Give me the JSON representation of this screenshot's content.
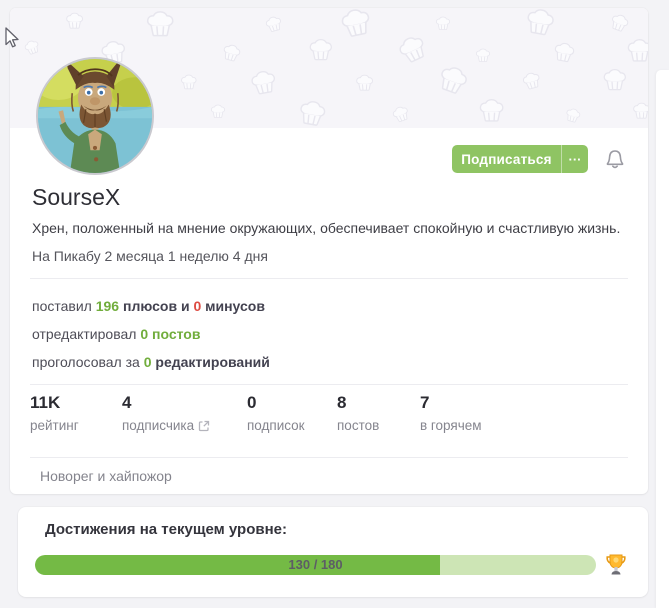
{
  "header": {
    "subscribe_label": "Подписаться",
    "more_label": "···"
  },
  "profile": {
    "username": "SourseX",
    "bio": "Хрен, положенный на мнение окружающих, обеспечивает спокойную и счастливую жизнь.",
    "tenure": "На Пикабу 2 месяца 1 неделю 4 дня"
  },
  "activity": {
    "line1": {
      "t1": "поставил ",
      "v1": "196",
      "t2": " плюсов и ",
      "v2": "0",
      "t3": " минусов"
    },
    "line2": {
      "t1": "отредактировал ",
      "v1": "0 постов"
    },
    "line3": {
      "t1": "проголосовал за ",
      "v1": "0",
      "t2": " редактирований"
    }
  },
  "counters": [
    {
      "value": "11K",
      "label": "рейтинг"
    },
    {
      "value": "4",
      "label": "подписчика"
    },
    {
      "value": "0",
      "label": "подписок"
    },
    {
      "value": "8",
      "label": "постов"
    },
    {
      "value": "7",
      "label": "в горячем"
    }
  ],
  "note": "Новорег и хайпожор",
  "achievements": {
    "title": "Достижения на текущем уровне:",
    "progress_label": "130 / 180",
    "current": 130,
    "max": 180
  },
  "colors": {
    "accent_green": "#8fc463",
    "text_green": "#71ad3c",
    "text_red": "#dd4b42",
    "progress_fill": "#74ba45",
    "progress_track": "#cde5b5"
  }
}
